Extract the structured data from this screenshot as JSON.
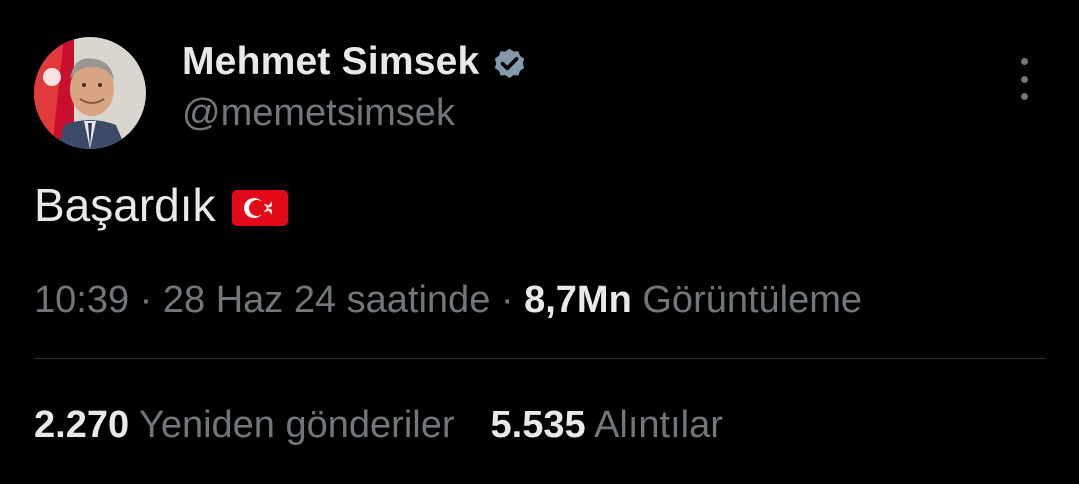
{
  "tweet": {
    "author": {
      "display_name": "Mehmet Simsek",
      "handle": "@memetsimsek",
      "verified_icon": "verified-badge-icon",
      "avatar_icon": "avatar"
    },
    "text": "Başardık",
    "emoji": "turkish-flag-icon",
    "meta": {
      "time": "10:39",
      "separator": "·",
      "date": "28 Haz 24 saatinde",
      "views_count": "8,7Mn",
      "views_label": "Görüntüleme"
    },
    "stats": {
      "reposts_count": "2.270",
      "reposts_label": "Yeniden gönderiler",
      "quotes_count": "5.535",
      "quotes_label": "Alıntılar"
    }
  },
  "colors": {
    "background": "#000000",
    "primary_text": "#e7e9ea",
    "secondary_text": "#71767b",
    "divider": "#2f3336",
    "verified": "#829aab",
    "flag_red": "#e30a17"
  }
}
